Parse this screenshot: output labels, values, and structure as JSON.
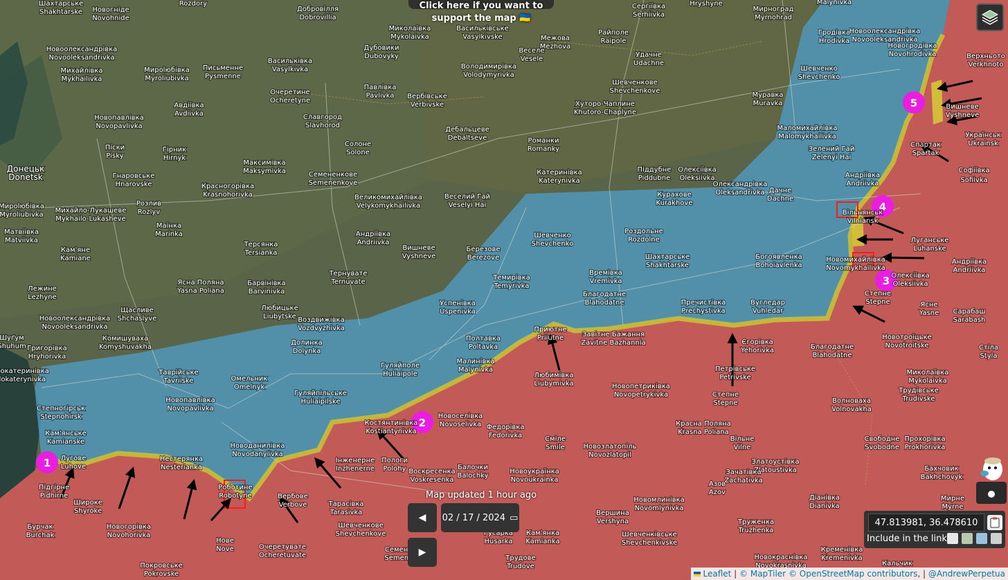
{
  "banner": {
    "line1": "Click here if you want to",
    "line2": "support the map 🇺🇦"
  },
  "map_update": {
    "text": "Map updated 1 hour ago"
  },
  "date_control": {
    "value": "02 / 17 / 2024",
    "prev_glyph": "◀",
    "next_glyph": "▶",
    "calendar_glyph": "▭"
  },
  "coordinates": {
    "value": "47.813981, 36.478610",
    "include_label": "Include in the link:"
  },
  "attribution": {
    "leaflet": "Leaflet",
    "maptiler": "© MapTiler",
    "osm": "© OpenStreetMap contributors",
    "author": "@AndrewPerpetua",
    "sep1": " | ",
    "sep2": " ",
    "sep3": ", | "
  },
  "colors": {
    "ukraine_control": "#4f9cc4",
    "russia_control": "#d9595b",
    "contested": "#cfc232",
    "marker": "#e91ee0"
  },
  "markers": [
    {
      "label": "1"
    },
    {
      "label": "2"
    },
    {
      "label": "3"
    },
    {
      "label": "4"
    },
    {
      "label": "5"
    }
  ],
  "places": [
    "Шахтарське",
    "Shakhtarske",
    "Новогнідe",
    "Novohnide",
    "Rozdory",
    "Добровілля",
    "Dobrovillia",
    "Миколаївка",
    "Mykolaivka",
    "Васильківське",
    "Vasylkivske",
    "Сергіївка",
    "Serhiivka",
    "Hryshyne",
    "Мирноград",
    "Myrnohrad",
    "Malynivka",
    "Новоолександрівка",
    "Novooleksandrivka",
    "Мирolюбівка",
    "Myroliubivka",
    "Дубовики",
    "Dubovyky",
    "Межова",
    "Mezhova",
    "Райполе",
    "Raipole",
    "Веселе",
    "Vesele",
    "Удачне",
    "Udachne",
    "Гродівка",
    "Hrodivka",
    "Новоолександрівка",
    "Novooleksandrivka",
    "Верхньото",
    "Verkhnoto",
    "Михайлівка",
    "Mykhailivka",
    "Письменне",
    "Pysmenne",
    "Васильківка",
    "Vasylkivka",
    "Володимирівка",
    "Volodymyrivka",
    "Шевченко",
    "Shevchenko",
    "Новогродівка",
    "Novohrodivka",
    "Очеретине",
    "Ocheretyne",
    "Павлівка",
    "Pavlivka",
    "Шевченкове",
    "Shevchenkove",
    "Муравка",
    "Muravka",
    "Вишневе",
    "Vyshneve",
    "Авдіївка",
    "Avdiivka",
    "Вербівське",
    "Verbivske",
    "Хуторо-Чаплине",
    "Khutoro-Chaplyne",
    "Новопавлівка",
    "Novopavlivka",
    "Славгород",
    "Slavhorod",
    "Дебальцеве",
    "Debaltseve",
    "Маломихайлівка",
    "Malomykhailivka",
    "Українськ",
    "Ukrainsk",
    "Спартак",
    "Spartak",
    "Піски",
    "Pisky",
    "Солоне",
    "Solone",
    "Романки",
    "Romanky",
    "Зелений Гай",
    "Zelenyi Hai",
    "Гірник",
    "Hirnyk",
    "Максимівка",
    "Maksymivka",
    "Софіївка",
    "Sofiivka",
    "Донецьк",
    "Donetsk",
    "Гнаровське",
    "Hnarovske",
    "Семененкове",
    "Semenenkove",
    "Катеринівка",
    "Katerynivka",
    "Піддубне",
    "Piddubne",
    "Олексіївка",
    "Oleksiivka",
    "Андріївка",
    "Andriivka",
    "Красногорівка",
    "Krasnohorivka",
    "Веселий Гай",
    "Veselyi Hai",
    "Великомихайлівка",
    "Velykomykhailivka",
    "Олександрівка",
    "Oleksandrivka",
    "Дачне",
    "Dachne",
    "Курахове",
    "Kurakhove",
    "Розлив",
    "Rozlyv",
    "Михайло-Лукашеве",
    "Mykhailo-Lukasheve",
    "Вільнянськ",
    "Vilniansk",
    "Маїнка",
    "Marinka",
    "Мирolюбівка",
    "Myroliubivka",
    "Матвіївка",
    "Matviivka",
    "Андріївка",
    "Andriivka",
    "Роздольне",
    "Rozdolne",
    "Шевченко",
    "Shevchenko",
    "Березове",
    "Berezove",
    "Луганське",
    "Luhanske",
    "Терсянка",
    "Tersianka",
    "Вишневе",
    "Vyshneve",
    "Кам'яне",
    "Kamiane",
    "Шахтарське",
    "Shakhtarske",
    "Богоявленка",
    "Bohoiavlenka",
    "Новомихайлівка",
    "Novomykhailivka",
    "Андріївка",
    "Andriivka",
    "Тернувате",
    "Ternuvate",
    "Темирівка",
    "Temyrivka",
    "Времівка",
    "Vremivka",
    "Олексіївка",
    "Oleksiivka",
    "Лежине",
    "Lezhyne",
    "Ясна Поляна",
    "Yasna Poliana",
    "Барвінівка",
    "Barvinivka",
    "Благодатне",
    "Blahodatne",
    "Степне",
    "Stepne",
    "Успенівка",
    "Uspenivka",
    "Пречистівка",
    "Prechystivka",
    "Вугледар",
    "Vuhledar",
    "Ясне",
    "Yasne",
    "Сарабаш",
    "Sarabash",
    "Щасливе",
    "Shchaslyve",
    "Любицьке",
    "Liubytske",
    "Новоолександрівка",
    "Novooleksandrivka",
    "Воздвижівка",
    "Vozdvyzhivka",
    "Приютне",
    "Priiutne",
    "Завітне Бажання",
    "Zavitne Bazhannia",
    "Полтавка",
    "Poltavka",
    "Благодатне",
    "Blahodatne",
    "Новотроїцьке",
    "Novotroitske",
    "Комишуваха",
    "Komyshuvakha",
    "Долинка",
    "Dolynka",
    "Єгорівка",
    "Yehorivka",
    "Стіла",
    "Styla",
    "Григорівка",
    "Hryhorivka",
    "Шуґум",
    "Shuhum",
    "Малинівка",
    "Malynivka",
    "Таврійське",
    "Tavriiske",
    "Гуляйполе",
    "Huliaipole",
    "Петрівське",
    "Petrivske",
    "Любимівка",
    "Liubymivka",
    "Миколаївка",
    "Mykolaivka",
    "Малокатеринівка",
    "Malokaterynivka",
    "Омельник",
    "Omelnyk",
    "Новопетриківка",
    "Novopetrykivka",
    "Гуляйпільське",
    "Huliaipilske",
    "Степне",
    "Stepne",
    "Волновaxa",
    "Volnovakha",
    "Трудівське",
    "Trudivske",
    "Новопавлівка",
    "Novopavlivka",
    "Степногірськ",
    "Stepnohirsk",
    "Костянтинівка",
    "Kostiantynivka",
    "Новоселівка",
    "Novoselivka",
    "Федорівка",
    "Fedorivka",
    "Красна Поляна",
    "Krasna Poliana",
    "Вільне",
    "Vilne",
    "Свободне",
    "Svobodne",
    "Прохорівка",
    "Prokhorivka",
    "Кам'янське",
    "Kamianske",
    "Смілe",
    "Smile",
    "Новозлатопіль",
    "Novozlatopil",
    "Новоданилівка",
    "Novodanylivka",
    "Лугове",
    "Luhove",
    "Нестерянка",
    "Nesterianka",
    "Інженерне",
    "Inzhenerne",
    "Пологи",
    "Polohy",
    "Балочки",
    "Balochky",
    "Воскресенка",
    "Voskresenka",
    "Новоукраїнка",
    "Novoukrainka",
    "Златоустівка",
    "Zlatoustivka",
    "Бахчовик",
    "Bakhchovyk",
    "Зачатівка",
    "Zachativka",
    "Азов",
    "Azov",
    "Підгірне",
    "Pidhirne",
    "Роботине",
    "Robotyne",
    "Вербове",
    "Verbove",
    "Широке",
    "Shyroke",
    "Новомлинівка",
    "Novomlynivka",
    "Мирне",
    "Myrne",
    "Діанівка",
    "Dianivka",
    "Бурчак",
    "Burchak",
    "Новогорівка",
    "Novohorivka",
    "Тарасівка",
    "Tarasivka",
    "Вершина",
    "Vershyna",
    "Шевченкове",
    "Shevchenkove",
    "Труженка",
    "Truzhenka",
    "Кам'янка",
    "Kamianka",
    "Гусарка",
    "Husarka",
    "Шевченківське",
    "Shevchenkivske",
    "Кременівка",
    "Kremenivka",
    "Нове",
    "Nove",
    "Семенівка",
    "Semenivka",
    "Очеретувате",
    "Ocheretuvate",
    "Трудове",
    "Trudove",
    "Покровське",
    "Pokrovske",
    "Новокраснівка",
    "Novokrasnivka",
    "Кальчик",
    "Kalchyk"
  ]
}
